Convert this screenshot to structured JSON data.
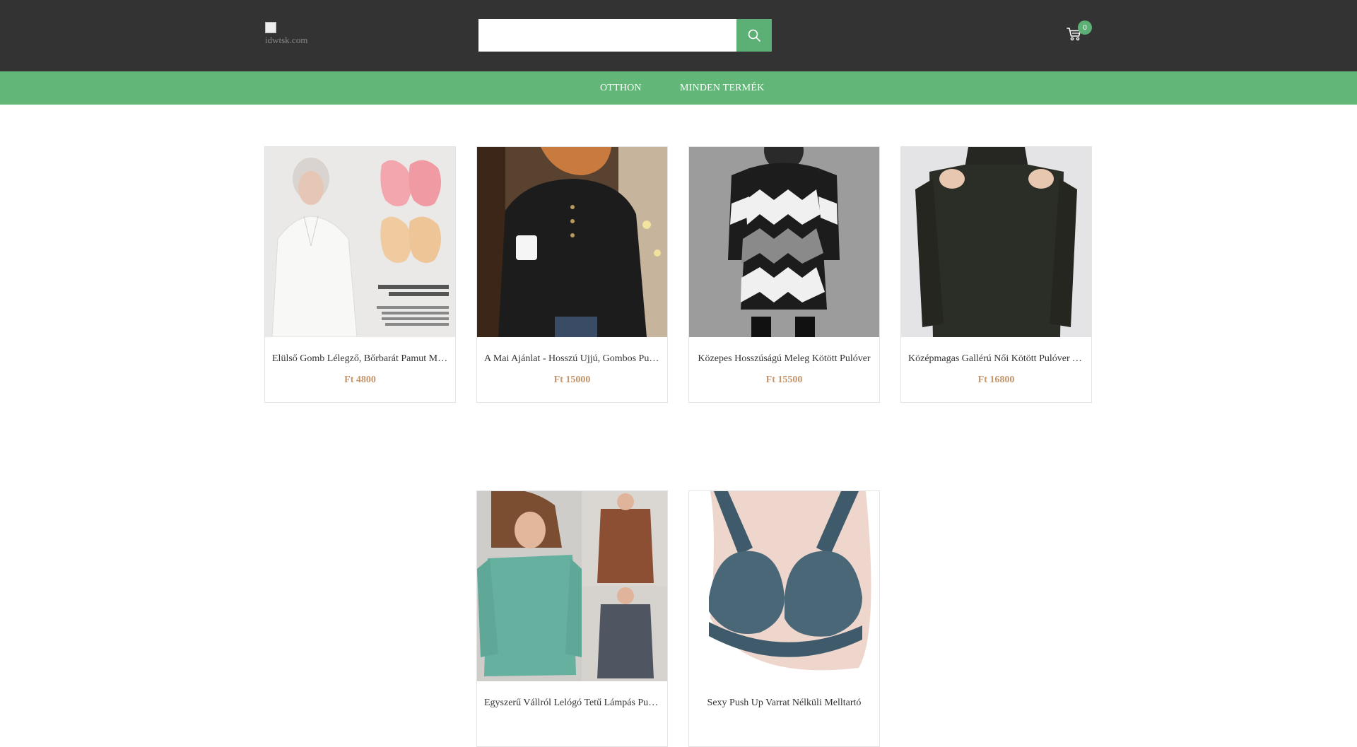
{
  "header": {
    "logo_alt": "idwtsk.com",
    "search_placeholder": "",
    "search_icon": "search-icon",
    "cart_icon": "cart-icon",
    "cart_count": "0"
  },
  "nav": {
    "items": [
      {
        "label": "OTTHON"
      },
      {
        "label": "MINDEN TERMÉK"
      }
    ]
  },
  "products": [
    {
      "title": "Elülső Gomb Lélegző, Bőrbarát Pamut Melltartó",
      "price": "Ft 4800"
    },
    {
      "title": "A Mai Ajánlat - Hosszú Ujjú, Gombos Pulóver",
      "price": "Ft 15000"
    },
    {
      "title": "Közepes Hosszúságú Meleg Kötött Pulóver",
      "price": "Ft 15500"
    },
    {
      "title": "Középmagas Gallérú Női Kötött Pulóver Vállkivágással",
      "price": "Ft 16800"
    },
    {
      "title": "Egyszerű Vállról Lelógó Tetű Lámpás Pulóver",
      "price": ""
    },
    {
      "title": "Sexy Push Up Varrat Nélküli Melltartó",
      "price": ""
    }
  ],
  "colors": {
    "topbar": "#333333",
    "navbar": "#62b677",
    "accent": "#5cb075",
    "price": "#c4956c"
  }
}
